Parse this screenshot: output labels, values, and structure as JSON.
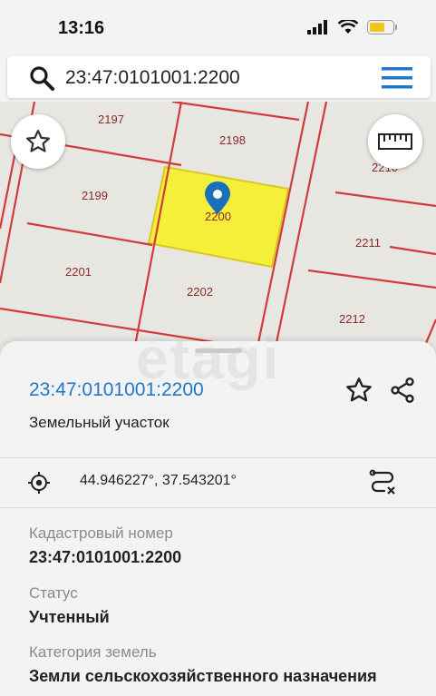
{
  "status_bar": {
    "time": "13:16"
  },
  "search": {
    "value": "23:47:0101001:2200"
  },
  "map": {
    "plots": [
      "2197",
      "2198",
      "2199",
      "2200",
      "2201",
      "2202",
      "2210",
      "2211",
      "2212"
    ],
    "highlight_color": "#f5ef3a",
    "line_color": "#d33a3a"
  },
  "card": {
    "title": "23:47:0101001:2200",
    "subtitle": "Земельный участок",
    "coordinates": "44.946227°, 37.543201°"
  },
  "fields": [
    {
      "label": "Кадастровый номер",
      "value": "23:47:0101001:2200"
    },
    {
      "label": "Статус",
      "value": "Учтенный"
    },
    {
      "label": "Категория земель",
      "value": "Земли сельскохозяйственного назначения"
    }
  ],
  "colors": {
    "accent": "#2277c9",
    "pin": "#1a6fb8"
  }
}
